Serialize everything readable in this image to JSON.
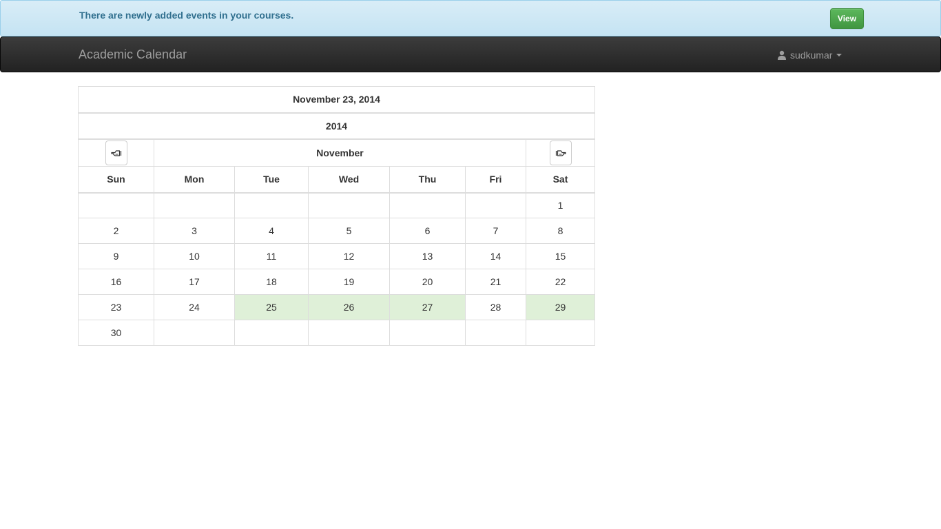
{
  "alert": {
    "message": "There are newly added events in your courses.",
    "view_label": "View"
  },
  "navbar": {
    "brand": "Academic Calendar",
    "username": "sudkumar"
  },
  "calendar": {
    "selected_date": "November 23, 2014",
    "year": "2014",
    "month": "November",
    "weekdays": [
      "Sun",
      "Mon",
      "Tue",
      "Wed",
      "Thu",
      "Fri",
      "Sat"
    ],
    "weeks": [
      [
        "",
        "",
        "",
        "",
        "",
        "",
        "1"
      ],
      [
        "2",
        "3",
        "4",
        "5",
        "6",
        "7",
        "8"
      ],
      [
        "9",
        "10",
        "11",
        "12",
        "13",
        "14",
        "15"
      ],
      [
        "16",
        "17",
        "18",
        "19",
        "20",
        "21",
        "22"
      ],
      [
        "23",
        "24",
        "25",
        "26",
        "27",
        "28",
        "29"
      ],
      [
        "30",
        "",
        "",
        "",
        "",
        "",
        ""
      ]
    ],
    "event_days": [
      "25",
      "26",
      "27",
      "29"
    ],
    "event_color": "#dff0d8"
  },
  "icons": {
    "prev": "hand-left-icon",
    "next": "hand-right-icon",
    "user": "user-icon"
  }
}
